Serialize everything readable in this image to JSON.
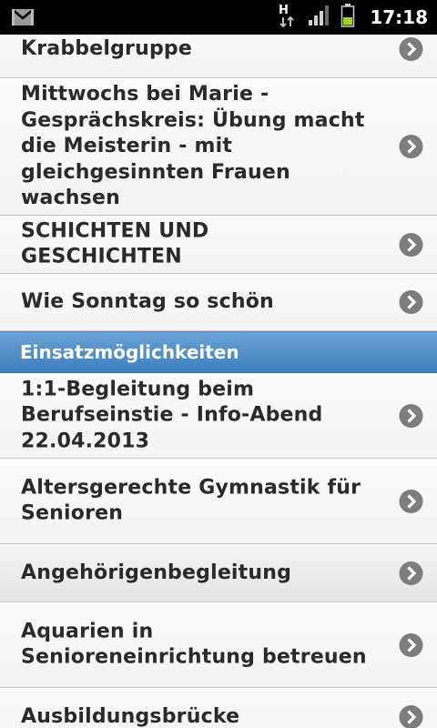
{
  "status_bar": {
    "time": "17:18",
    "network_type": "H",
    "icons": [
      "gmail-notification-icon",
      "h-data-icon",
      "signal-icon",
      "battery-icon"
    ]
  },
  "list": {
    "rows_top": [
      {
        "label": "Krabbelgruppe"
      },
      {
        "label": "Mittwochs bei Marie - Gesprächskreis: Übung macht die Meisterin - mit gleichgesinnten Frauen wachsen"
      },
      {
        "label": "SCHICHTEN UND GESCHICHTEN"
      },
      {
        "label": "Wie Sonntag so schön"
      }
    ],
    "section_header": "Einsatzmöglichkeiten",
    "rows_bottom": [
      {
        "label": "1:1-Begleitung beim Berufseinstie - Info-Abend 22.04.2013"
      },
      {
        "label": "Altersgerechte Gymnastik für Senioren"
      },
      {
        "label": "Angehörigenbegleitung"
      },
      {
        "label": "Aquarien in Senioreneinrichtung betreuen"
      },
      {
        "label": "Ausbildungsbrücke"
      }
    ],
    "chevron_icon": "chevron-right-circle-icon"
  },
  "colors": {
    "section_header_bg": "#4a8ac6",
    "row_bg": "#f5f5f5",
    "text": "#2a2a2a",
    "chevron": "#7d7d7d"
  }
}
